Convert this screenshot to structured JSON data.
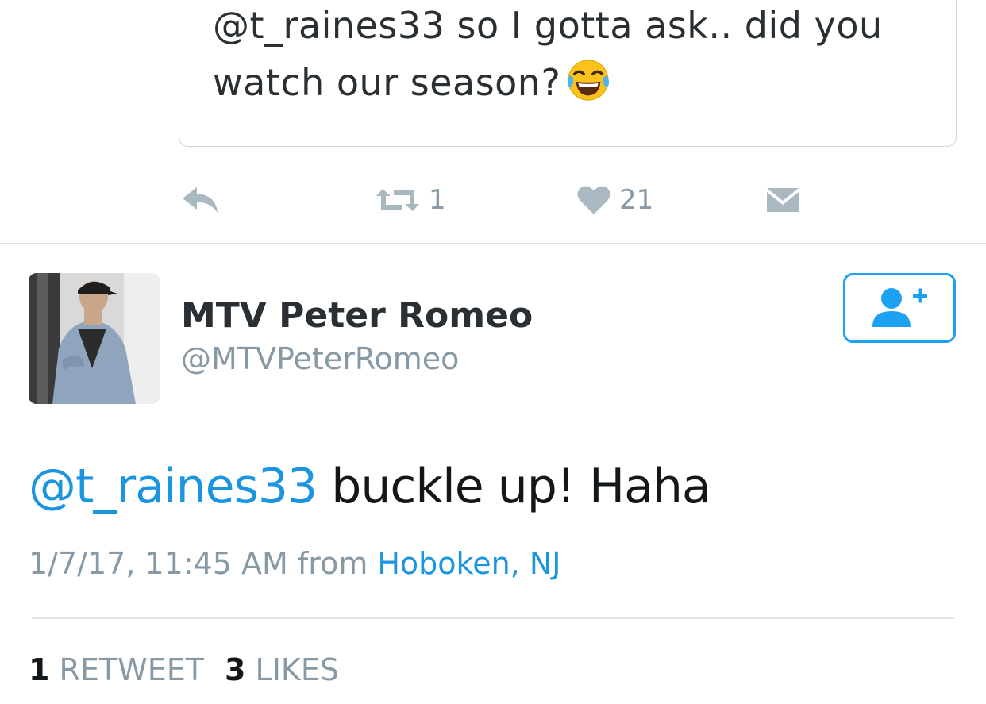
{
  "quoted_tweet": {
    "text": "@t_raines33 so I gotta ask.. did you watch our season?",
    "emoji_icon": "face-with-tears-of-joy-icon"
  },
  "actions": {
    "reply_icon": "reply-icon",
    "retweet_icon": "retweet-icon",
    "retweet_count": "1",
    "like_icon": "heart-icon",
    "like_count": "21",
    "dm_icon": "envelope-icon"
  },
  "author": {
    "display_name": "MTV Peter Romeo",
    "handle": "@MTVPeterRomeo"
  },
  "follow_button": {
    "icon": "add-user-icon"
  },
  "tweet": {
    "mention": "@t_raines33",
    "text": " buckle up! Haha",
    "timestamp": "1/7/17, 11:45 AM from",
    "location": "Hoboken, NJ"
  },
  "stats": {
    "retweets_num": "1",
    "retweets_label": "RETWEET",
    "likes_num": "3",
    "likes_label": "LIKES"
  },
  "colors": {
    "accent": "#1da1f2",
    "link": "#1b95e0",
    "muted": "#8899a6",
    "icon_gray": "#aab8c2"
  }
}
